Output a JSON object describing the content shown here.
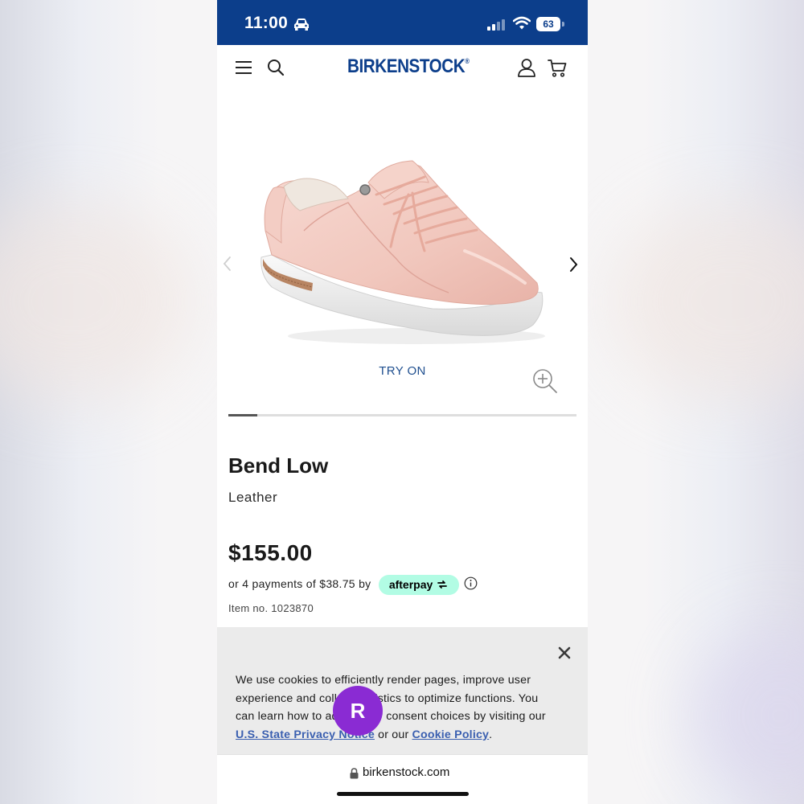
{
  "status_bar": {
    "time": "11:00",
    "battery": "63",
    "icons": [
      "car-icon",
      "signal-icon",
      "wifi-icon",
      "battery-icon"
    ]
  },
  "header": {
    "logo": "BIRKENSTOCK",
    "logo_mark": "®",
    "icons": [
      "menu-icon",
      "search-icon",
      "user-icon",
      "cart-icon"
    ]
  },
  "gallery": {
    "try_on_label": "TRY ON",
    "image_position": 1,
    "progress_fraction": 0.083,
    "icons": [
      "chevron-left-icon",
      "chevron-right-icon",
      "zoom-in-icon"
    ]
  },
  "product": {
    "title": "Bend Low",
    "material": "Leather",
    "price": "$155.00",
    "installments_text": "or 4 payments of $38.75 by",
    "afterpay_label": "afterpay",
    "item_number": "Item no. 1023870"
  },
  "cookie_banner": {
    "text_part1": "We use cookies to efficiently render pages, improve user experience and collect statistics to optimize functions. You can learn how to adjust your consent choices by visiting our ",
    "link_privacy": "U.S. State Privacy Notice",
    "text_part2": " or our ",
    "link_cookie": "Cookie Policy",
    "text_part3": "."
  },
  "rakuten": {
    "label": "R"
  },
  "browser": {
    "url": "birkenstock.com"
  },
  "colors": {
    "brand_blue": "#0c3e8b",
    "afterpay_mint": "#b2fce4",
    "rakuten_purple": "#8a2bd3",
    "link_blue": "#3a5fb0"
  }
}
